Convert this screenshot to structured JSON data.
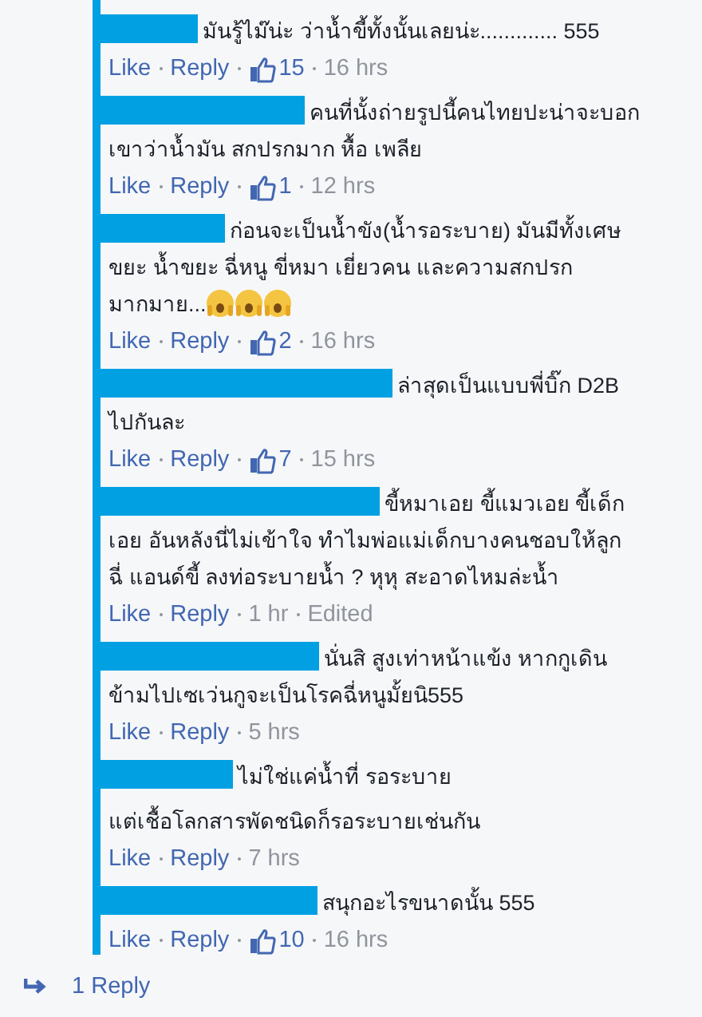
{
  "comments": [
    {
      "paragraphs": [
        "มันรู้ไม๊น่ะ ว่าน้ำขี้ทั้งนั้นเลยน่ะ............. 555"
      ],
      "emoji_after": false,
      "like": "Like",
      "reply": "Reply",
      "likes": "15",
      "time": "16 hrs"
    },
    {
      "paragraphs": [
        "คนที่นั้งถ่ายรูปนี้คนไทยปะน่าจะบอก\nเขาว่าน้ำมัน สกปรกมาก หื้อ เพลีย"
      ],
      "emoji_after": false,
      "like": "Like",
      "reply": "Reply",
      "likes": "1",
      "time": "12 hrs"
    },
    {
      "paragraphs": [
        "ก่อนจะเป็นน้ำขัง(น้ำรอระบาย) มันมีทั้งเศษ\nขยะ น้ำขยะ ฉี่หนู ขี่หมา เยี่ยวคน และความสกปรก\nมากมาย..."
      ],
      "emoji_after": true,
      "like": "Like",
      "reply": "Reply",
      "likes": "2",
      "time": "16 hrs"
    },
    {
      "paragraphs": [
        "ล่าสุดเป็นแบบพี่บิ๊ก D2B\nไปกันละ"
      ],
      "emoji_after": false,
      "like": "Like",
      "reply": "Reply",
      "likes": "7",
      "time": "15 hrs"
    },
    {
      "paragraphs": [
        "ขี้หมาเอย ขี้แมวเอย ขี้เด็ก\nเอย อันหลังนี่ไม่เข้าใจ ทำไมพ่อแม่เด็กบางคนชอบให้ลูก\nฉี่ แอนด์ขี้ ลงท่อระบายน้ำ ? หุหุ สะอาดไหมล่ะน้ำ"
      ],
      "emoji_after": false,
      "like": "Like",
      "reply": "Reply",
      "time": "1 hr",
      "edited": "Edited"
    },
    {
      "paragraphs": [
        "นั่นสิ สูงเท่าหน้าแข้ง หากกูเดิน\nข้ามไปเซเว่นกูจะเป็นโรคฉี่หนูมั้ยนิ555"
      ],
      "emoji_after": false,
      "like": "Like",
      "reply": "Reply",
      "time": "5 hrs"
    },
    {
      "paragraphs": [
        "ไม่ใช่แค่น้ำที่ รอระบาย",
        "แต่เชื้อโลกสารพัดชนิดก็รอระบายเช่นกัน"
      ],
      "emoji_after": false,
      "like": "Like",
      "reply": "Reply",
      "time": "7 hrs"
    },
    {
      "paragraphs": [
        "สนุกอะไรขนาดนั้น 555"
      ],
      "emoji_after": false,
      "like": "Like",
      "reply": "Reply",
      "likes": "10",
      "time": "16 hrs"
    }
  ],
  "replies_link": "1 Reply"
}
